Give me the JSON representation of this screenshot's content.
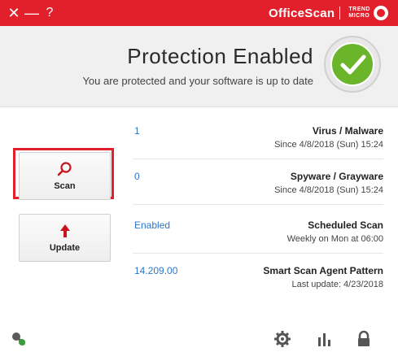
{
  "titlebar": {
    "product": "OfficeScan",
    "brand_line1": "TREND",
    "brand_line2": "MICRO",
    "help_label": "?",
    "minimize_label": "—",
    "close_label": "✕"
  },
  "header": {
    "title": "Protection Enabled",
    "subtitle": "You are protected and your software is up to date"
  },
  "actions": {
    "scan_label": "Scan",
    "update_label": "Update"
  },
  "status": [
    {
      "label": "Virus / Malware",
      "value": "1",
      "sub": "Since 4/8/2018 (Sun) 15:24"
    },
    {
      "label": "Spyware / Grayware",
      "value": "0",
      "sub": "Since 4/8/2018 (Sun) 15:24"
    },
    {
      "label": "Scheduled Scan",
      "value": "Enabled",
      "sub": "Weekly on Mon at 06:00"
    },
    {
      "label": "Smart Scan Agent Pattern",
      "value": "14.209.00",
      "sub": "Last update: 4/23/2018"
    }
  ],
  "bottombar": {
    "icons": [
      "lock-icon",
      "stats-icon",
      "gear-icon",
      "connection-icon"
    ]
  },
  "colors": {
    "brand_red": "#e2202b",
    "ok_green": "#6bb52b",
    "link_blue": "#2f75c7"
  }
}
